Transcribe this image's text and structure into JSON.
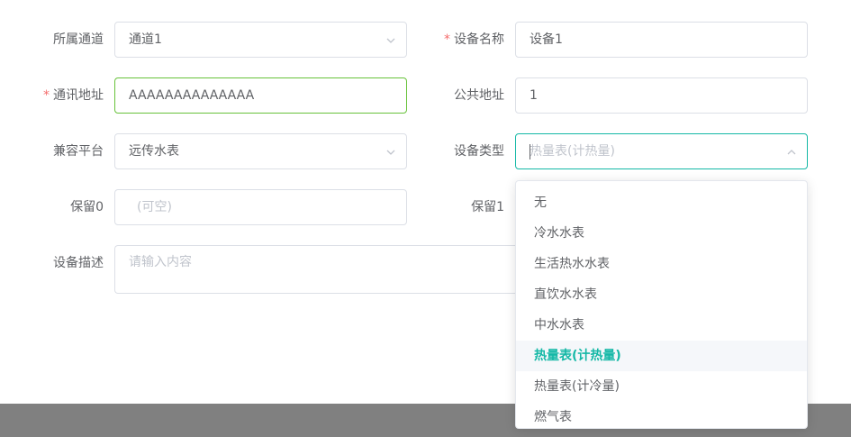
{
  "form": {
    "channel": {
      "label": "所属通道",
      "value": "通道1"
    },
    "device_name": {
      "label": "设备名称",
      "value": "设备1",
      "required_mark": "*"
    },
    "comm_address": {
      "label": "通讯地址",
      "value": "AAAAAAAAAAAAAA",
      "required_mark": "*"
    },
    "public_address": {
      "label": "公共地址",
      "value": "1"
    },
    "platform": {
      "label": "兼容平台",
      "value": "远传水表"
    },
    "device_type": {
      "label": "设备类型",
      "placeholder": "热量表(计热量)"
    },
    "reserved0": {
      "label": "保留0",
      "placeholder": "(可空)"
    },
    "reserved1": {
      "label": "保留1"
    },
    "description": {
      "label": "设备描述",
      "placeholder": "请输入内容"
    }
  },
  "dropdown": {
    "options": [
      "无",
      "冷水水表",
      "生活热水水表",
      "直饮水水表",
      "中水水表",
      "热量表(计热量)",
      "热量表(计冷量)",
      "燃气表"
    ],
    "selected_index": 5
  },
  "colors": {
    "accent": "#14b8a6",
    "success_border": "#67c23a",
    "required": "#f56c6c",
    "backdrop": "#808080"
  }
}
